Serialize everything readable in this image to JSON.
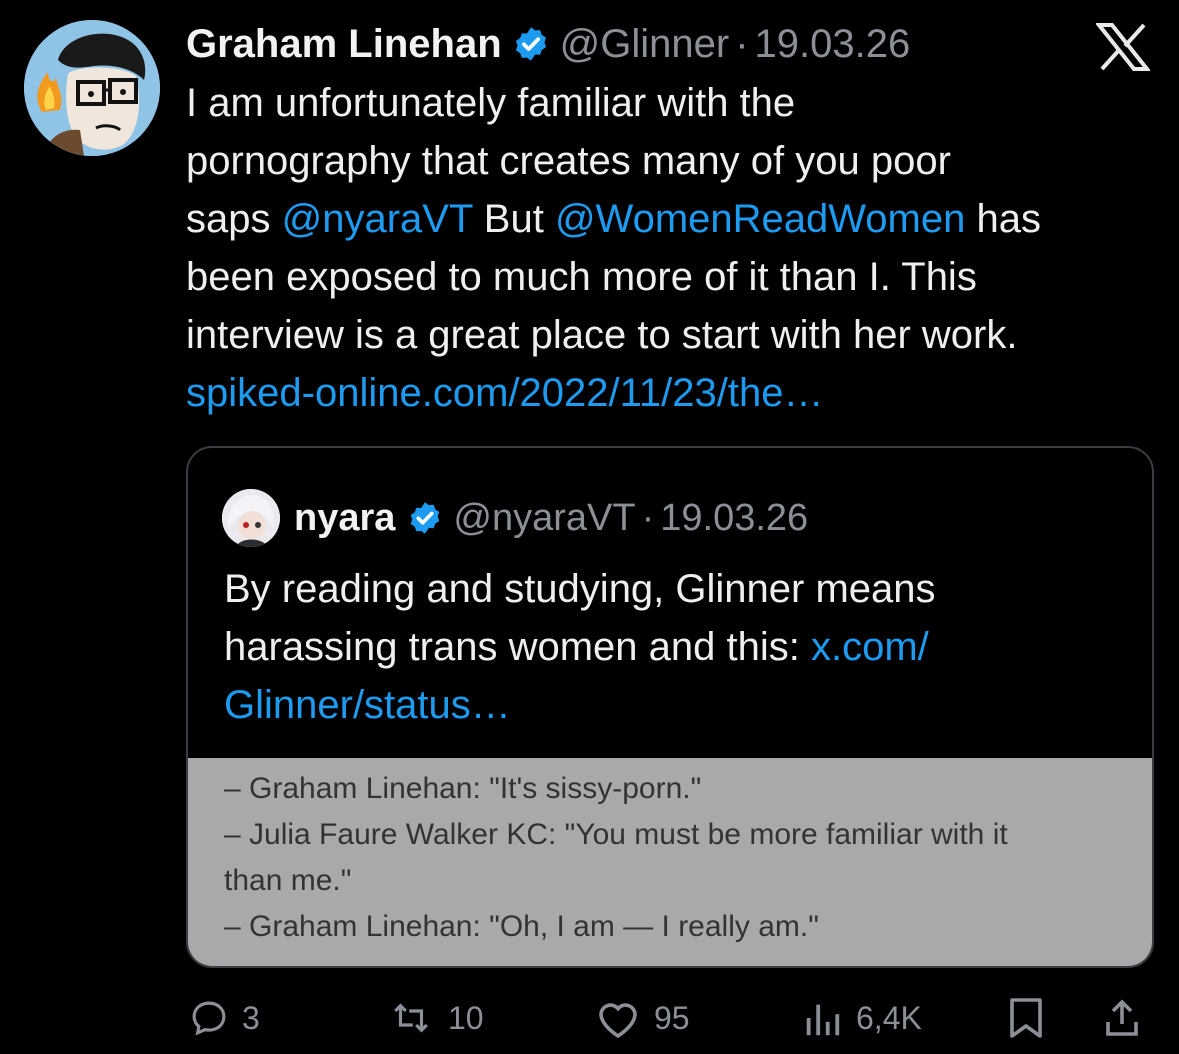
{
  "post": {
    "author": "Graham Linehan",
    "handle": "@Glinner",
    "separator": "·",
    "date": "19.03.26",
    "lines": [
      [
        {
          "t": "I am unfortunately familiar with the"
        }
      ],
      [
        {
          "t": "pornography that creates many of you poor"
        }
      ],
      [
        {
          "t": "saps "
        },
        {
          "t": "@nyaraVT",
          "link": true
        },
        {
          "t": "   But "
        },
        {
          "t": "@WomenReadWomen",
          "link": true
        },
        {
          "t": " has"
        }
      ],
      [
        {
          "t": "been exposed to much more of it than I. This"
        }
      ],
      [
        {
          "t": "interview is a great place to start with her work."
        }
      ],
      [
        {
          "t": "spiked-online.com/2022/11/23/the…",
          "link": true
        }
      ]
    ]
  },
  "quote": {
    "author": "nyara",
    "handle": "@nyaraVT",
    "separator": "·",
    "date": "19.03.26",
    "lines": [
      [
        {
          "t": "By reading and studying, Glinner means"
        }
      ],
      [
        {
          "t": "harassing trans women and this: "
        },
        {
          "t": "x.com/",
          "link": true
        }
      ],
      [
        {
          "t": "Glinner/status…",
          "link": true
        }
      ]
    ],
    "image_lines": [
      "– Graham Linehan: \"It's sissy-porn.\"",
      "– Julia Faure Walker KC: \"You must be more familiar with it",
      "than me.\"",
      "– Graham Linehan: \"Oh, I am — I really am.\""
    ]
  },
  "actions": {
    "replies": "3",
    "reposts": "10",
    "likes": "95",
    "views": "6,4K"
  },
  "icons": {
    "verified": "verified-badge-icon",
    "logo": "x-logo-icon",
    "reply": "reply-icon",
    "repost": "repost-icon",
    "like": "heart-icon",
    "views": "views-chart-icon",
    "bookmark": "bookmark-icon",
    "share": "share-icon"
  },
  "colors": {
    "background": "#000000",
    "link": "#1d9bf0",
    "muted": "#8b9096",
    "verified": "#1d9bf0"
  }
}
